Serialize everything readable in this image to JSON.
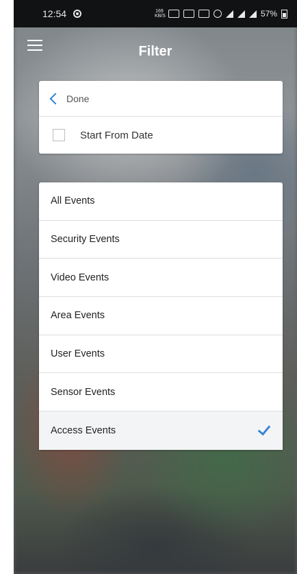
{
  "status_bar": {
    "time": "12:54",
    "speed": "169 KB/S",
    "battery": "57%"
  },
  "header": {
    "title": "Filter"
  },
  "filter_card": {
    "done_label": "Done",
    "start_from_date_label": "Start From Date",
    "start_from_date_checked": false
  },
  "events": {
    "items": [
      {
        "label": "All Events",
        "selected": false
      },
      {
        "label": "Security Events",
        "selected": false
      },
      {
        "label": "Video Events",
        "selected": false
      },
      {
        "label": "Area Events",
        "selected": false
      },
      {
        "label": "User Events",
        "selected": false
      },
      {
        "label": "Sensor Events",
        "selected": false
      },
      {
        "label": "Access Events",
        "selected": true
      }
    ]
  },
  "colors": {
    "accent": "#3a86d6"
  }
}
